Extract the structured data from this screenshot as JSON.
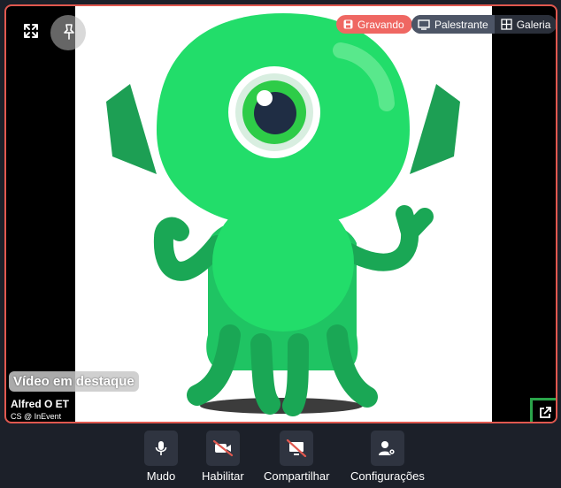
{
  "recording": {
    "label": "Gravando",
    "color": "#ef6762"
  },
  "layout_toggle": {
    "speaker_label": "Palestrante",
    "gallery_label": "Galeria",
    "active": "Palestrante"
  },
  "featured": {
    "lead": "Vídeo em ",
    "rest": "destaque"
  },
  "participant": {
    "name": "Alfred O ET",
    "org": "CS @ InEvent"
  },
  "icons": {
    "expand": "expand-icon",
    "pin": "pin-icon",
    "popout": "external-link-icon"
  },
  "toolbar": {
    "mute_label": "Mudo",
    "enable_label": "Habilitar",
    "share_label": "Compartilhar",
    "settings_label": "Configurações"
  },
  "colors": {
    "stage_border": "#e0584f",
    "popout_border": "#2aa44a",
    "alien": "#22dd6a"
  }
}
